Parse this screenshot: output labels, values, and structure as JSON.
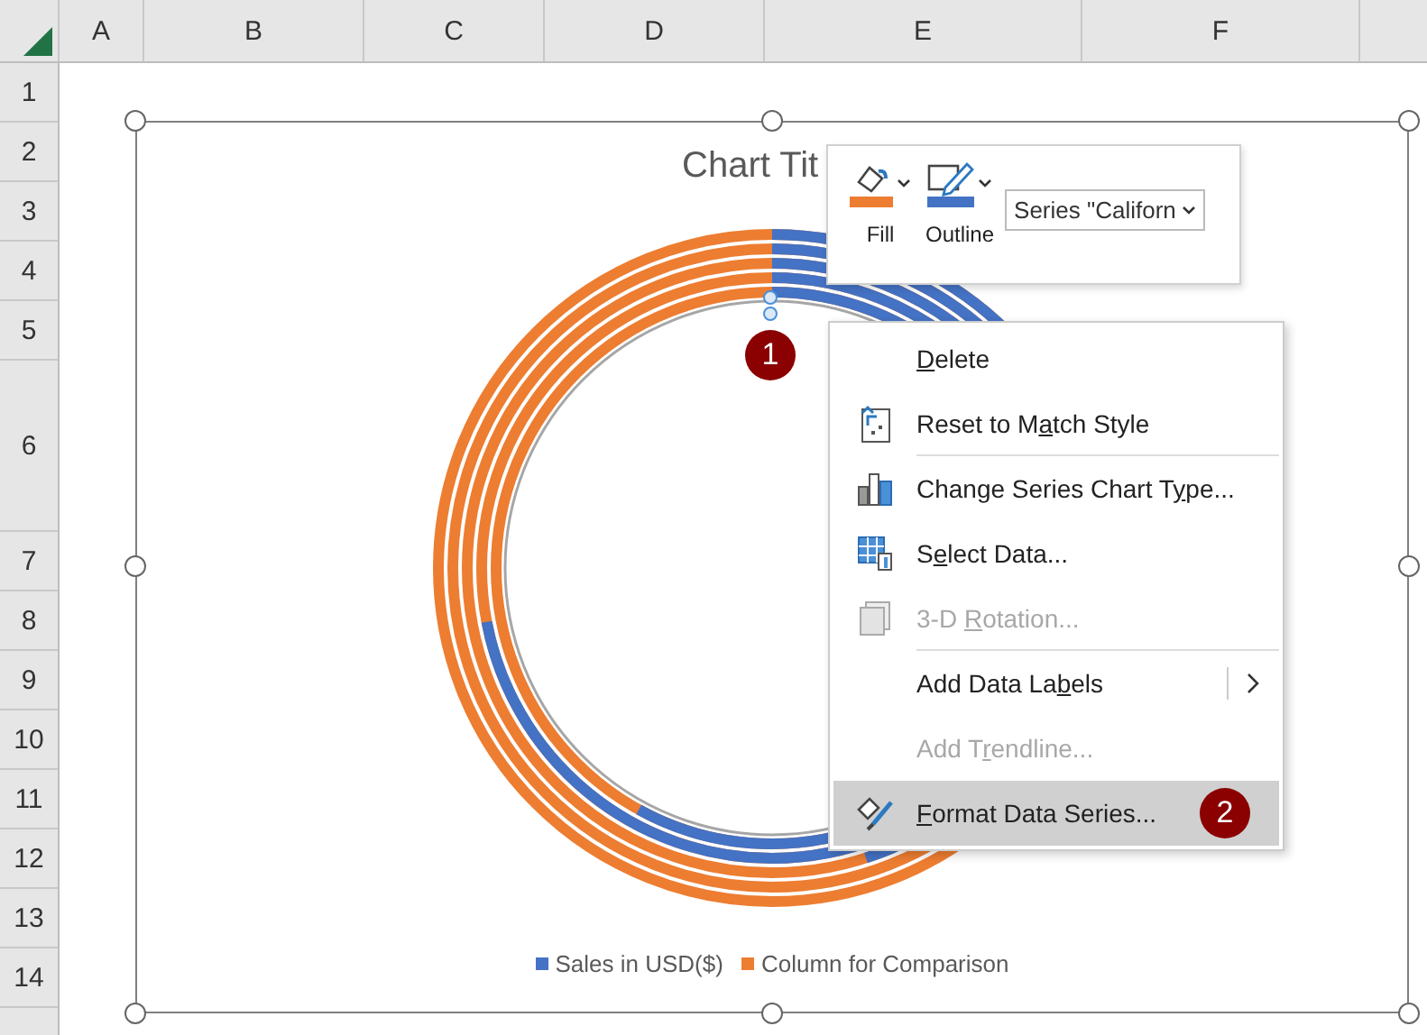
{
  "sheet": {
    "columns": [
      "A",
      "B",
      "C",
      "D",
      "E",
      "F"
    ],
    "rows": [
      "1",
      "2",
      "3",
      "4",
      "5",
      "6",
      "7",
      "8",
      "9",
      "10",
      "11",
      "12",
      "13",
      "14"
    ]
  },
  "chart": {
    "title": "Chart Tit",
    "step_marker": "1",
    "legend": [
      {
        "label": "Sales in USD($)",
        "color": "#4472c4"
      },
      {
        "label": "Column for Comparison",
        "color": "#ed7d31"
      }
    ]
  },
  "mini_toolbar": {
    "buttons": [
      {
        "label": "Fill",
        "kind": "fill"
      },
      {
        "label": "Outline",
        "kind": "outline"
      }
    ],
    "series_dropdown": {
      "value": "Series \"Californ"
    }
  },
  "context_menu": {
    "items": [
      {
        "key": "D",
        "post": "elete",
        "kind": "plain",
        "disabled": false,
        "selected": false,
        "divider_after": false,
        "has_submenu": false
      },
      {
        "pre": "Reset to M",
        "key": "a",
        "post": "tch Style",
        "kind": "reset",
        "disabled": false,
        "selected": false,
        "divider_after": true,
        "has_submenu": false
      },
      {
        "pre": "Change Series Chart T",
        "key": "y",
        "post": "pe...",
        "kind": "charttype",
        "disabled": false,
        "selected": false,
        "divider_after": false,
        "has_submenu": false
      },
      {
        "pre": "S",
        "key": "e",
        "post": "lect Data...",
        "kind": "selectdata",
        "disabled": false,
        "selected": false,
        "divider_after": false,
        "has_submenu": false
      },
      {
        "pre": "3-D ",
        "key": "R",
        "post": "otation...",
        "kind": "rotation",
        "disabled": true,
        "selected": false,
        "divider_after": true,
        "has_submenu": false
      },
      {
        "pre": "Add Data La",
        "key": "b",
        "post": "els",
        "kind": "plain",
        "disabled": false,
        "selected": false,
        "divider_after": false,
        "has_submenu": true
      },
      {
        "pre": "Add T",
        "key": "r",
        "post": "endline...",
        "kind": "plain",
        "disabled": true,
        "selected": false,
        "divider_after": false,
        "has_submenu": false
      },
      {
        "key": "F",
        "post": "ormat Data Series...",
        "kind": "format",
        "disabled": false,
        "selected": true,
        "divider_after": false,
        "has_submenu": false,
        "badge": "2"
      }
    ]
  }
}
